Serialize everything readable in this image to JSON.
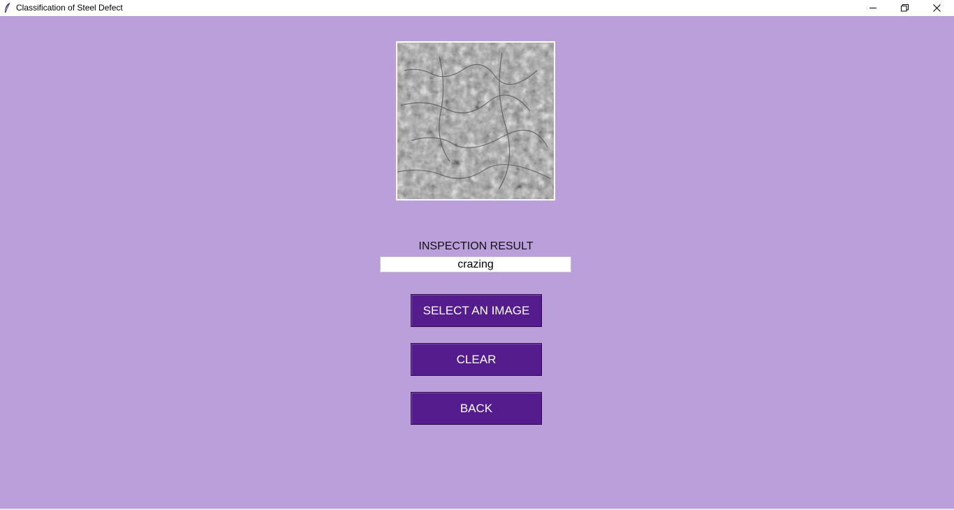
{
  "window": {
    "title": "Classification of Steel Defect",
    "app_icon": "feather-icon",
    "controls": {
      "minimize_icon": "minimize-icon",
      "maximize_icon": "restore-icon",
      "close_icon": "close-icon"
    }
  },
  "main": {
    "image": {
      "description_icon": "steel-surface-image",
      "border_color": "#ffffff"
    },
    "result_label": "INSPECTION RESULT",
    "result_value": "crazing",
    "buttons": {
      "select_image": "SELECT AN IMAGE",
      "clear": "CLEAR",
      "back": "BACK"
    }
  },
  "colors": {
    "background": "#ba9fda",
    "button": "#551c8e",
    "button_text": "#ffffff"
  }
}
